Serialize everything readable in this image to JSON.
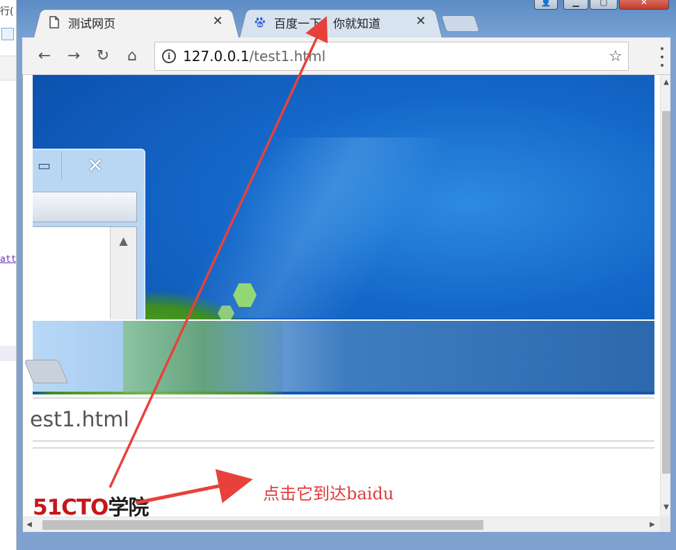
{
  "background_app": {
    "text_fragment": "行(",
    "link_fragment": "att"
  },
  "window_controls": {
    "user": "👤",
    "minimize": "▁",
    "maximize": "▢",
    "close": "✕"
  },
  "tabs": [
    {
      "title": "测试网页",
      "icon": "page-icon",
      "active": true,
      "close": "✕"
    },
    {
      "title": "百度一下，你就知道",
      "icon": "baidu-paw-icon",
      "active": false,
      "close": "✕"
    }
  ],
  "toolbar": {
    "back": "←",
    "forward": "→",
    "reload": "↻",
    "home": "⌂",
    "info_icon": "i",
    "url_host": "127.0.0.1",
    "url_path": "/test1.html",
    "star": "☆"
  },
  "page": {
    "mini_window": {
      "restore": "▭",
      "close": "✕",
      "scroll_up": "▲"
    },
    "address_fragment": "est1.html",
    "link_text": "点击它到达baidu",
    "logo": {
      "part1": "51CTO",
      "part2": "学院"
    }
  },
  "scrollbars": {
    "up": "▲",
    "down": "▼",
    "left": "◀",
    "right": "▶"
  },
  "colors": {
    "annotation_arrow": "#e8413b",
    "link_red": "#e23a3a",
    "logo_red": "#c4171c"
  }
}
